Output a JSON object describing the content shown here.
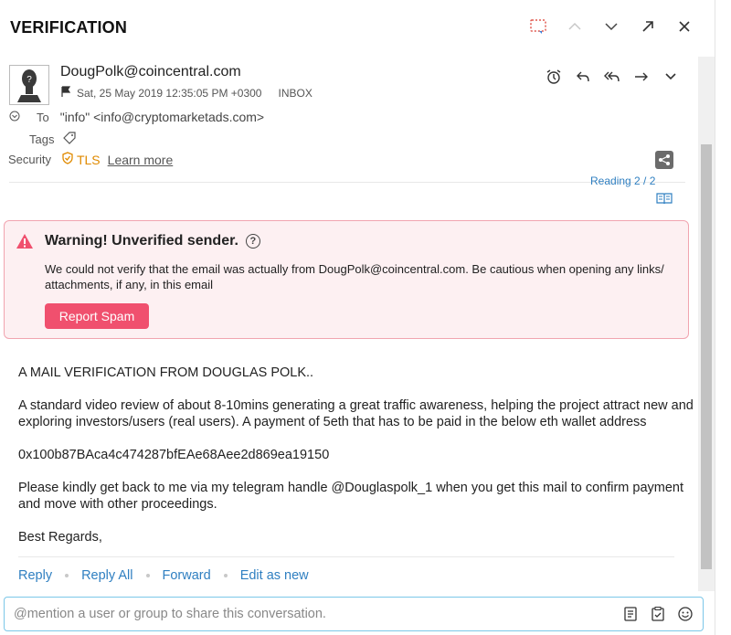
{
  "header": {
    "title": "VERIFICATION"
  },
  "message": {
    "sender": "DougPolk@coincentral.com",
    "date": "Sat, 25 May 2019 12:35:05 PM +0300",
    "folder": "INBOX",
    "to_label": "To",
    "to_value": "\"info\" <info@cryptomarketads.com>",
    "tags_label": "Tags",
    "security_label": "Security",
    "tls": "TLS",
    "learn_more": "Learn more",
    "reading": "Reading 2 / 2"
  },
  "warning": {
    "title": "Warning! Unverified sender.",
    "help": "?",
    "text": "We could not verify that the email was actually from DougPolk@coincentral.com. Be cautious when opening any links/ attachments, if any, in this email",
    "button": "Report Spam"
  },
  "body": {
    "p1": "A MAIL VERIFICATION FROM DOUGLAS POLK..",
    "p2": "A standard video review of about 8-10mins generating a great traffic awareness, helping the project attract new and exploring investors/users (real users). A payment of 5eth that has to be paid in the below eth wallet address",
    "p3": "0x100b87BAca4c474287bfEAe68Aee2d869ea19150",
    "p4": "Please kindly get back to me via my telegram handle @Douglaspolk_1 when you get this mail to confirm payment and move with other proceedings.",
    "p5": "Best Regards,"
  },
  "reply_bar": {
    "reply": "Reply",
    "reply_all": "Reply All",
    "forward": "Forward",
    "edit_as_new": "Edit as new"
  },
  "composer": {
    "placeholder": "@mention a user or group to share this conversation."
  },
  "colors": {
    "accent": "#2f7fc1",
    "warning_bg": "#fdf0f2",
    "warning_border": "#f1a5b0",
    "spam_button": "#f0506e",
    "tls": "#e08a00"
  }
}
